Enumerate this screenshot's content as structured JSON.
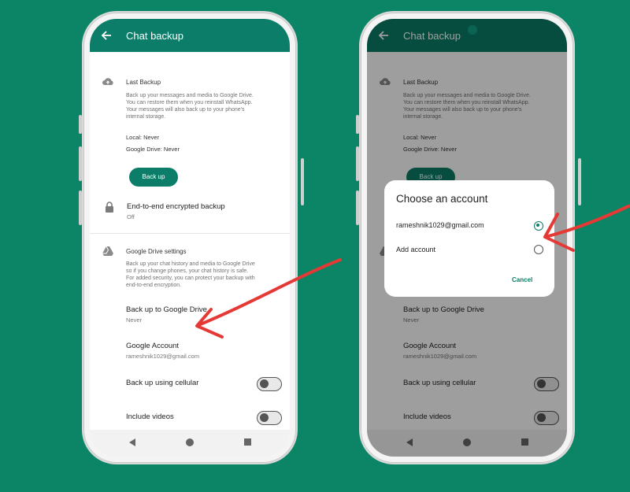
{
  "colors": {
    "background": "#0c8466",
    "accent": "#0b7d68",
    "arrow": "#e53935"
  },
  "left_phone": {
    "app_bar": {
      "title": "Chat backup",
      "back_icon": "arrow-left-icon"
    },
    "last_backup": {
      "icon": "cloud-upload-icon",
      "title": "Last Backup",
      "description": [
        "Back up your messages and media to Google Drive.",
        "You can restore them when you reinstall WhatsApp.",
        "Your messages will also back up to your phone's",
        "internal storage."
      ],
      "local": "Local: Never",
      "google_drive": "Google Drive: Never",
      "button": "Back up"
    },
    "e2e": {
      "icon": "lock-icon",
      "title": "End-to-end encrypted backup",
      "value": "Off"
    },
    "drive_settings": {
      "icon": "google-drive-icon",
      "title": "Google Drive settings",
      "description": [
        "Back up your chat history and media to Google Drive",
        "so if you change phones, your chat history is safe.",
        "For added security, you can protect your backup with",
        "end-to-end encryption."
      ],
      "items": [
        {
          "title": "Back up to Google Drive",
          "subtitle": "Never"
        },
        {
          "title": "Google Account",
          "subtitle": "rameshnik1029@gmail.com"
        },
        {
          "title": "Back up using cellular",
          "toggle": "off"
        },
        {
          "title": "Include videos",
          "toggle": "off"
        }
      ]
    }
  },
  "right_phone": {
    "dialog": {
      "title": "Choose an account",
      "options": [
        {
          "label": "rameshnik1029@gmail.com",
          "selected": true
        },
        {
          "label": "Add account",
          "selected": false
        }
      ],
      "cancel": "Cancel"
    }
  }
}
